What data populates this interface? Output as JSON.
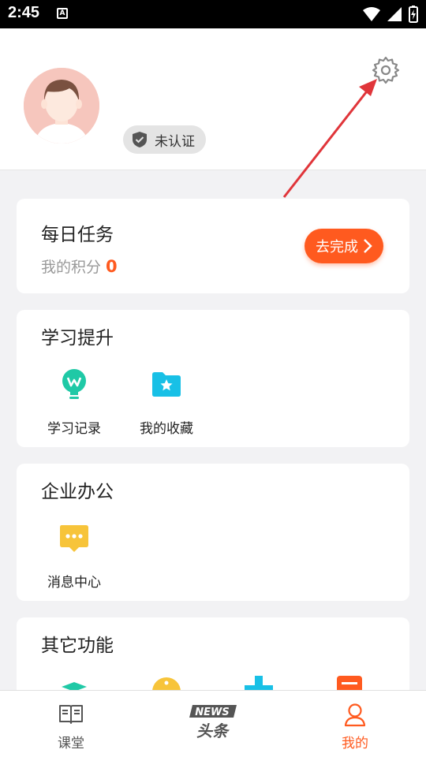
{
  "status_bar": {
    "time": "2:45",
    "indicator": "A"
  },
  "profile": {
    "cert_label": "未认证"
  },
  "daily_task": {
    "title": "每日任务",
    "points_label": "我的积分",
    "points_value": "0",
    "button_label": "去完成"
  },
  "learning": {
    "title": "学习提升",
    "items": [
      {
        "label": "学习记录",
        "icon": "lightbulb-icon"
      },
      {
        "label": "我的收藏",
        "icon": "star-folder-icon"
      }
    ]
  },
  "office": {
    "title": "企业办公",
    "items": [
      {
        "label": "消息中心",
        "icon": "chat-bubble-icon"
      }
    ]
  },
  "other": {
    "title": "其它功能"
  },
  "tabbar": {
    "tabs": [
      {
        "label": "课堂",
        "icon": "book-icon"
      },
      {
        "label": "NEWS 头条",
        "icon": "news-logo"
      },
      {
        "label": "我的",
        "icon": "user-icon",
        "active": true
      }
    ],
    "news_logo_text_top": "NEWS",
    "news_logo_text_bottom": "头条"
  },
  "colors": {
    "accent": "#ff5a1f",
    "teal": "#1fc9a6",
    "cyan": "#18c0e6",
    "yellow": "#f7c43a",
    "arrow_red": "#e0353a"
  }
}
